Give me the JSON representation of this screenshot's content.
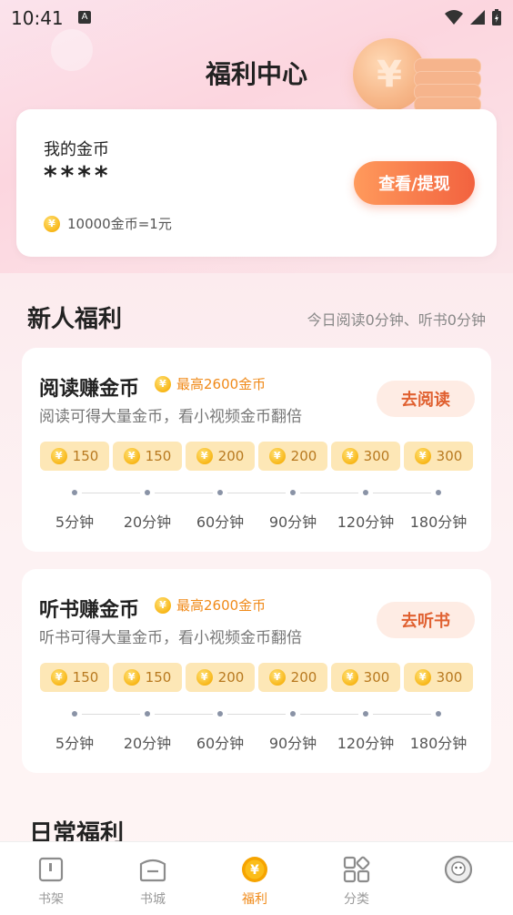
{
  "status_bar": {
    "time": "10:41",
    "notif": "A"
  },
  "page": {
    "title": "福利中心"
  },
  "wallet": {
    "label": "我的金币",
    "value": "****",
    "button": "查看/提现",
    "rate": "10000金币=1元"
  },
  "newbie": {
    "title": "新人福利",
    "subtitle": "今日阅读0分钟、听书0分钟",
    "tasks": [
      {
        "title": "阅读赚金币",
        "max": "最高2600金币",
        "desc": "阅读可得大量金币，看小视频金币翻倍",
        "button": "去阅读",
        "rewards": [
          "150",
          "150",
          "200",
          "200",
          "300",
          "300"
        ],
        "minutes": [
          "5分钟",
          "20分钟",
          "60分钟",
          "90分钟",
          "120分钟",
          "180分钟"
        ]
      },
      {
        "title": "听书赚金币",
        "max": "最高2600金币",
        "desc": "听书可得大量金币，看小视频金币翻倍",
        "button": "去听书",
        "rewards": [
          "150",
          "150",
          "200",
          "200",
          "300",
          "300"
        ],
        "minutes": [
          "5分钟",
          "20分钟",
          "60分钟",
          "90分钟",
          "120分钟",
          "180分钟"
        ]
      }
    ]
  },
  "daily": {
    "title": "日常福利"
  },
  "coin_symbol": "¥",
  "tabbar": {
    "active_color": "#f08a19",
    "items": [
      {
        "label": "书架",
        "icon": "bookshelf-icon"
      },
      {
        "label": "书城",
        "icon": "bookstore-icon"
      },
      {
        "label": "福利",
        "icon": "coin-icon"
      },
      {
        "label": "分类",
        "icon": "category-icon"
      },
      {
        "label": "",
        "icon": "profile-avatar-icon"
      }
    ]
  }
}
